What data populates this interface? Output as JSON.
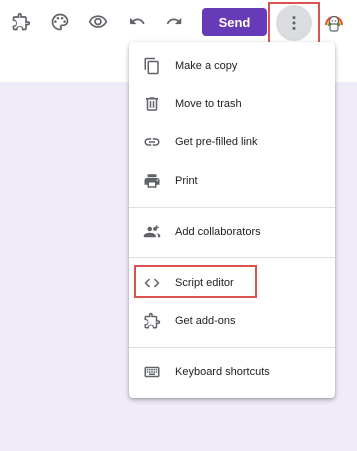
{
  "toolbar": {
    "icons": [
      "add-ons-icon",
      "palette-icon",
      "preview-eye-icon",
      "undo-icon",
      "redo-icon"
    ],
    "send_label": "Send",
    "more_icon": "more-vert-icon",
    "accent_color": "#673ab7"
  },
  "menu": {
    "items": [
      {
        "label": "Make a copy",
        "icon": "copy-icon"
      },
      {
        "label": "Move to trash",
        "icon": "trash-icon"
      },
      {
        "label": "Get pre-filled link",
        "icon": "link-icon"
      },
      {
        "label": "Print",
        "icon": "print-icon"
      },
      {
        "label": "Add collaborators",
        "icon": "add-people-icon"
      },
      {
        "label": "Script editor",
        "icon": "code-icon"
      },
      {
        "label": "Get add-ons",
        "icon": "puzzle-icon"
      },
      {
        "label": "Keyboard shortcuts",
        "icon": "keyboard-icon"
      }
    ]
  },
  "canvas_color": "#f0ebf8"
}
